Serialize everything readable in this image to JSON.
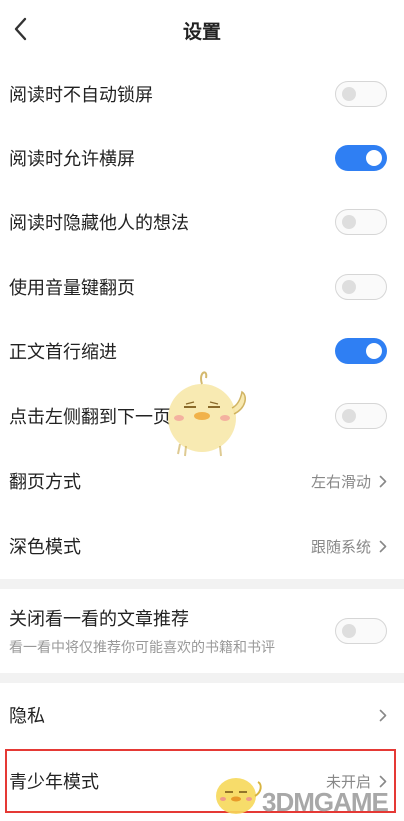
{
  "header": {
    "title": "设置"
  },
  "toggles": [
    {
      "label": "阅读时不自动锁屏",
      "state": "off"
    },
    {
      "label": "阅读时允许横屏",
      "state": "on"
    },
    {
      "label": "阅读时隐藏他人的想法",
      "state": "off"
    },
    {
      "label": "使用音量键翻页",
      "state": "off"
    },
    {
      "label": "正文首行缩进",
      "state": "on"
    },
    {
      "label": "点击左侧翻到下一页",
      "state": "off"
    }
  ],
  "options": [
    {
      "label": "翻页方式",
      "value": "左右滑动"
    },
    {
      "label": "深色模式",
      "value": "跟随系统"
    }
  ],
  "recommend": {
    "label": "关闭看一看的文章推荐",
    "subtext": "看一看中将仅推荐你可能喜欢的书籍和书评",
    "state": "off"
  },
  "privacy": {
    "label": "隐私"
  },
  "youth_mode": {
    "label": "青少年模式",
    "value": "未开启"
  },
  "colors": {
    "accent": "#2f7ff3",
    "highlight": "#e53935"
  },
  "watermark": {
    "text": "3DMGAME"
  }
}
